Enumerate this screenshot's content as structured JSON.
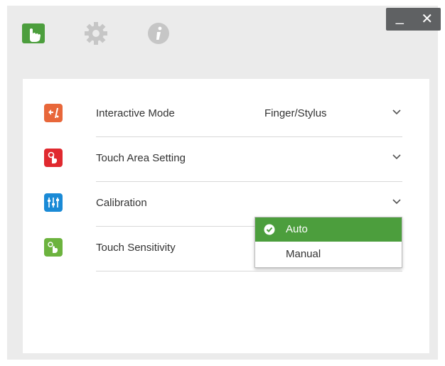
{
  "window": {
    "controls": {
      "minimize_label": "_",
      "close_label": "✕"
    },
    "tabs": [
      {
        "name": "touch-tab",
        "icon": "touch-hand-icon",
        "color": "#4c9e3d"
      },
      {
        "name": "settings-tab",
        "icon": "gear-icon",
        "color": "#c9c9c9"
      },
      {
        "name": "info-tab",
        "icon": "info-icon",
        "color": "#c9c9c9"
      }
    ]
  },
  "settings": {
    "rows": [
      {
        "label": "Interactive Mode",
        "value": "Finger/Stylus",
        "icon": "interactive-mode-icon",
        "color": "#e8673a"
      },
      {
        "label": "Touch Area Setting",
        "value": "",
        "icon": "touch-area-icon",
        "color": "#e0292f"
      },
      {
        "label": "Calibration",
        "value": "",
        "icon": "calibration-sliders-icon",
        "color": "#1a8ad6"
      },
      {
        "label": "Touch Sensitivity",
        "value": "",
        "icon": "touch-sensitivity-icon",
        "color": "#6cb33e"
      }
    ]
  },
  "calibration_dropdown": {
    "options": [
      {
        "label": "Auto",
        "selected": true
      },
      {
        "label": "Manual",
        "selected": false
      }
    ],
    "selected_color": "#4c9e3d"
  }
}
